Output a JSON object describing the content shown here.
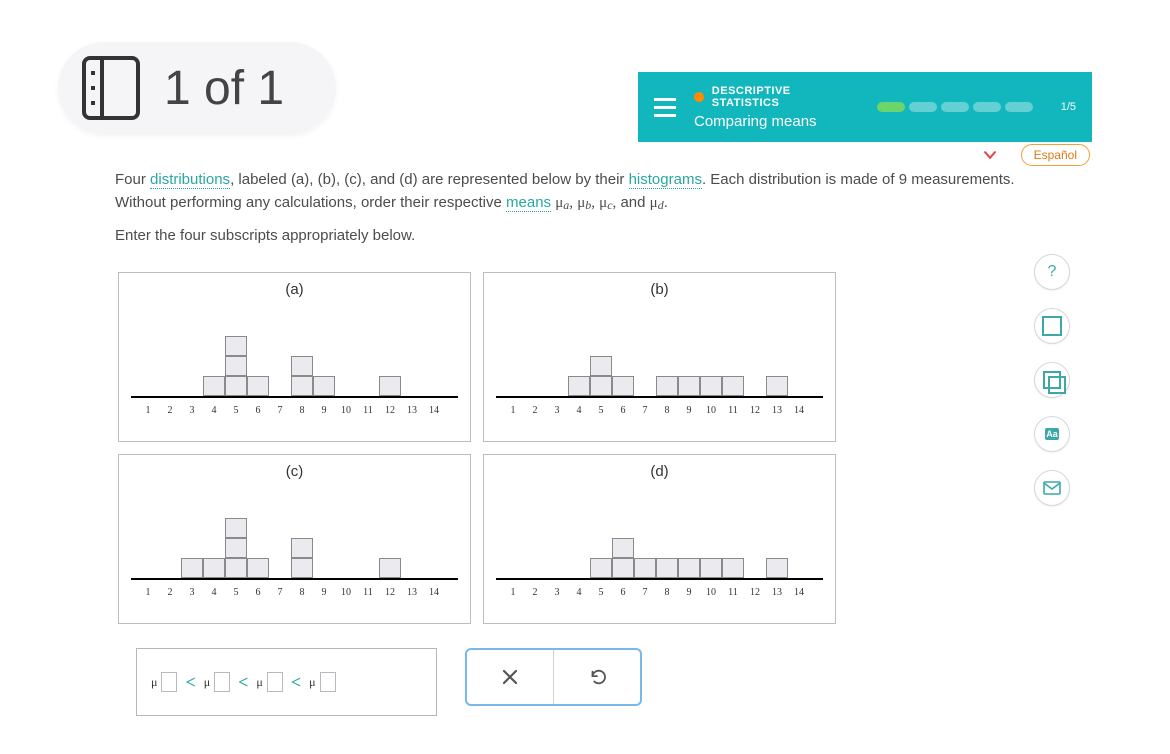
{
  "overlay": {
    "page_label": "1 of 1"
  },
  "header": {
    "category": "DESCRIPTIVE STATISTICS",
    "lesson_title": "Comparing means",
    "progress_text": "1/5",
    "segments_total": 5,
    "segments_filled": 1
  },
  "language_button": "Español",
  "body": {
    "text_before_dist": "Four ",
    "term_distributions": "distributions",
    "text_mid": ", labeled (a), (b), (c), and (d) are represented below by their ",
    "term_histograms": "histograms",
    "text_after_hist": ". Each distribution is made of ",
    "count": "9",
    "text_after_count": " measurements. Without performing any calculations, order their respective ",
    "term_means": "means",
    "mu_list_tail": ".",
    "instruction": "Enter the four subscripts appropriately below."
  },
  "charts": {
    "a": "(a)",
    "b": "(b)",
    "c": "(c)",
    "d": "(d)",
    "xticks": [
      "1",
      "2",
      "3",
      "4",
      "5",
      "6",
      "7",
      "8",
      "9",
      "10",
      "11",
      "12",
      "13",
      "14"
    ]
  },
  "chart_data": [
    {
      "type": "bar",
      "label": "(a)",
      "categories": [
        1,
        2,
        3,
        4,
        5,
        6,
        7,
        8,
        9,
        10,
        11,
        12,
        13,
        14
      ],
      "values": [
        0,
        0,
        0,
        1,
        3,
        1,
        0,
        2,
        1,
        0,
        0,
        1,
        0,
        0
      ],
      "xlabel": "",
      "ylabel": "",
      "ylim": [
        0,
        3
      ]
    },
    {
      "type": "bar",
      "label": "(b)",
      "categories": [
        1,
        2,
        3,
        4,
        5,
        6,
        7,
        8,
        9,
        10,
        11,
        12,
        13,
        14
      ],
      "values": [
        0,
        0,
        0,
        1,
        2,
        1,
        0,
        1,
        1,
        1,
        1,
        0,
        1,
        0
      ],
      "xlabel": "",
      "ylabel": "",
      "ylim": [
        0,
        3
      ]
    },
    {
      "type": "bar",
      "label": "(c)",
      "categories": [
        1,
        2,
        3,
        4,
        5,
        6,
        7,
        8,
        9,
        10,
        11,
        12,
        13,
        14
      ],
      "values": [
        0,
        0,
        1,
        1,
        3,
        1,
        0,
        2,
        0,
        0,
        0,
        1,
        0,
        0
      ],
      "xlabel": "",
      "ylabel": "",
      "ylim": [
        0,
        3
      ]
    },
    {
      "type": "bar",
      "label": "(d)",
      "categories": [
        1,
        2,
        3,
        4,
        5,
        6,
        7,
        8,
        9,
        10,
        11,
        12,
        13,
        14
      ],
      "values": [
        0,
        0,
        0,
        0,
        1,
        2,
        1,
        1,
        1,
        1,
        1,
        0,
        1,
        0
      ],
      "xlabel": "",
      "ylabel": "",
      "ylim": [
        0,
        3
      ]
    }
  ],
  "answer": {
    "mu": "μ",
    "lt": "<"
  },
  "tools": {
    "help": "?",
    "font": "Aa"
  }
}
